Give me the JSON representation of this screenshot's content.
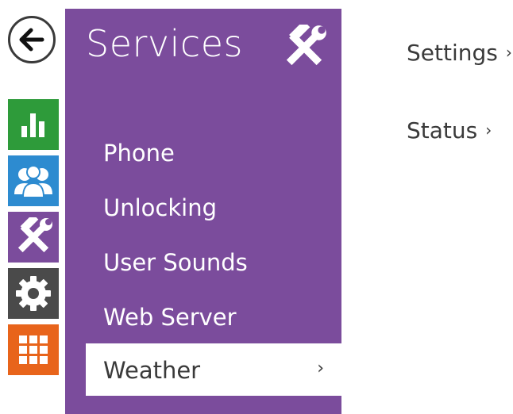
{
  "colors": {
    "panel": "#7b4c9c",
    "status_tile": "#2e9b3a",
    "directory_tile": "#2d8bd0",
    "services_tile": "#7b4c9c",
    "hardware_tile": "#4a4a4a",
    "system_tile": "#e8641b",
    "text_dark": "#3a3a3a"
  },
  "nav": {
    "back_icon": "arrow-left-icon",
    "tiles": [
      {
        "name": "status",
        "icon": "bar-chart-icon"
      },
      {
        "name": "directory",
        "icon": "users-icon"
      },
      {
        "name": "services",
        "icon": "tools-icon"
      },
      {
        "name": "hardware",
        "icon": "gear-icon"
      },
      {
        "name": "system",
        "icon": "grid-icon"
      }
    ]
  },
  "panel": {
    "title": "Services",
    "title_icon": "tools-icon",
    "items": [
      {
        "label": "Phone"
      },
      {
        "label": "Unlocking"
      },
      {
        "label": "User Sounds"
      },
      {
        "label": "Web Server"
      },
      {
        "label": "Weather",
        "active": true,
        "chevron": "›"
      }
    ]
  },
  "content": {
    "links": [
      {
        "label": "Settings",
        "chevron": "›"
      },
      {
        "label": "Status",
        "chevron": "›"
      }
    ]
  }
}
